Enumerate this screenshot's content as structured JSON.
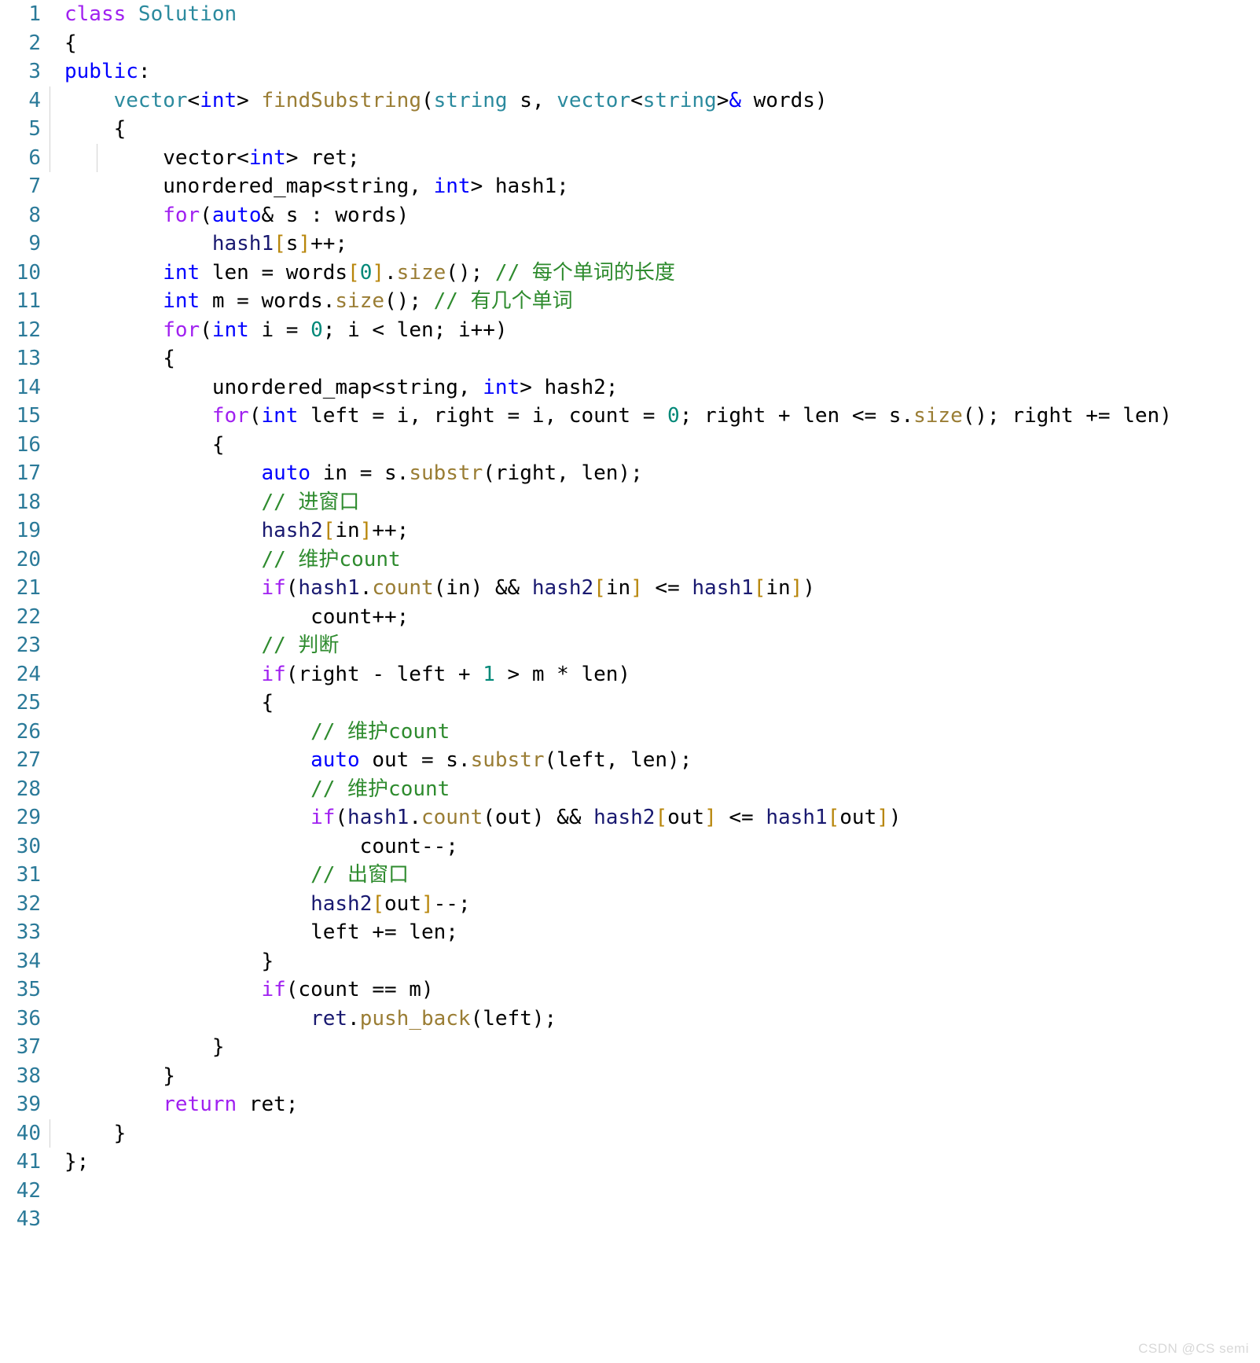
{
  "document": {
    "kind": "code-snippet",
    "language": "C++",
    "background_color": "#ffffff",
    "gutter_color": "#2b7a99",
    "watermark": "CSDN @CS semi"
  },
  "palette": {
    "keyword": "#a020f0",
    "type": "#0000ff",
    "return_type": "#2b8a9e",
    "function": "#9a7d34",
    "number": "#008878",
    "identifier": "#191970",
    "bracket": "#b8860b",
    "comment": "#2e8b2e",
    "plain": "#000000",
    "line_number": "#2b7a99"
  },
  "lines": [
    {
      "n": "1",
      "text": "class Solution"
    },
    {
      "n": "2",
      "text": "{"
    },
    {
      "n": "3",
      "text": "public:"
    },
    {
      "n": "4",
      "text": "    vector<int> findSubstring(string s, vector<string>& words)"
    },
    {
      "n": "5",
      "text": "    {"
    },
    {
      "n": "6",
      "text": "        vector<int> ret;"
    },
    {
      "n": "7",
      "text": "        unordered_map<string, int> hash1;"
    },
    {
      "n": "8",
      "text": "        for(auto& s : words)"
    },
    {
      "n": "9",
      "text": "            hash1[s]++;"
    },
    {
      "n": "10",
      "text": "        int len = words[0].size(); // 每个单词的长度"
    },
    {
      "n": "11",
      "text": "        int m = words.size(); // 有几个单词"
    },
    {
      "n": "12",
      "text": "        for(int i = 0; i < len; i++)"
    },
    {
      "n": "13",
      "text": "        {"
    },
    {
      "n": "14",
      "text": "            unordered_map<string, int> hash2;"
    },
    {
      "n": "15",
      "text": "            for(int left = i, right = i, count = 0; right + len <= s.size(); right += len)"
    },
    {
      "n": "16",
      "text": "            {"
    },
    {
      "n": "17",
      "text": "                auto in = s.substr(right, len);"
    },
    {
      "n": "18",
      "text": "                // 进窗口"
    },
    {
      "n": "19",
      "text": "                hash2[in]++;"
    },
    {
      "n": "20",
      "text": "                // 维护count"
    },
    {
      "n": "21",
      "text": "                if(hash1.count(in) && hash2[in] <= hash1[in])"
    },
    {
      "n": "22",
      "text": "                    count++;"
    },
    {
      "n": "23",
      "text": "                // 判断"
    },
    {
      "n": "24",
      "text": "                if(right - left + 1 > m * len)"
    },
    {
      "n": "25",
      "text": "                {"
    },
    {
      "n": "26",
      "text": "                    // 维护count"
    },
    {
      "n": "27",
      "text": "                    auto out = s.substr(left, len);"
    },
    {
      "n": "28",
      "text": "                    // 维护count"
    },
    {
      "n": "29",
      "text": "                    if(hash1.count(out) && hash2[out] <= hash1[out])"
    },
    {
      "n": "30",
      "text": "                        count--;"
    },
    {
      "n": "31",
      "text": "                    // 出窗口"
    },
    {
      "n": "32",
      "text": "                    hash2[out]--;"
    },
    {
      "n": "33",
      "text": "                    left += len;"
    },
    {
      "n": "34",
      "text": "                }"
    },
    {
      "n": "35",
      "text": "                if(count == m)"
    },
    {
      "n": "36",
      "text": "                    ret.push_back(left);"
    },
    {
      "n": "37",
      "text": "            }"
    },
    {
      "n": "38",
      "text": "        }"
    },
    {
      "n": "39",
      "text": "        return ret;"
    },
    {
      "n": "40",
      "text": "    }"
    },
    {
      "n": "41",
      "text": "};"
    },
    {
      "n": "42",
      "text": ""
    },
    {
      "n": "43",
      "text": ""
    }
  ],
  "highlighted_lines": [
    {
      "n": "1",
      "guides": [],
      "tokens": [
        {
          "t": "class ",
          "c": "kw"
        },
        {
          "t": "Solution",
          "c": "rettype"
        }
      ]
    },
    {
      "n": "2",
      "guides": [],
      "tokens": [
        {
          "t": "{",
          "c": "plain"
        }
      ]
    },
    {
      "n": "3",
      "guides": [],
      "tokens": [
        {
          "t": "public",
          "c": "type"
        },
        {
          "t": ":",
          "c": "plain"
        }
      ]
    },
    {
      "n": "4",
      "guides": [
        "g1"
      ],
      "tokens": [
        {
          "t": "    ",
          "c": "plain"
        },
        {
          "t": "vector",
          "c": "rettype"
        },
        {
          "t": "<",
          "c": "plain"
        },
        {
          "t": "int",
          "c": "type"
        },
        {
          "t": "> ",
          "c": "plain"
        },
        {
          "t": "findSubstring",
          "c": "fn"
        },
        {
          "t": "(",
          "c": "plain"
        },
        {
          "t": "string",
          "c": "rettype"
        },
        {
          "t": " s, ",
          "c": "plain"
        },
        {
          "t": "vector",
          "c": "rettype"
        },
        {
          "t": "<",
          "c": "plain"
        },
        {
          "t": "string",
          "c": "rettype"
        },
        {
          "t": ">",
          "c": "plain"
        },
        {
          "t": "&",
          "c": "amp"
        },
        {
          "t": " words)",
          "c": "plain"
        }
      ]
    },
    {
      "n": "5",
      "guides": [
        "g1"
      ],
      "tokens": [
        {
          "t": "    {",
          "c": "plain"
        }
      ]
    },
    {
      "n": "6",
      "guides": [
        "g1",
        "g2"
      ],
      "tokens": [
        {
          "t": "        vector",
          "c": "plain"
        },
        {
          "t": "<",
          "c": "plain"
        },
        {
          "t": "int",
          "c": "type"
        },
        {
          "t": "> ret;",
          "c": "plain"
        }
      ]
    },
    {
      "n": "7",
      "guides": [],
      "tokens": [
        {
          "t": "        unordered_map<string, ",
          "c": "plain"
        },
        {
          "t": "int",
          "c": "type"
        },
        {
          "t": "> hash1;",
          "c": "plain"
        }
      ]
    },
    {
      "n": "8",
      "guides": [],
      "tokens": [
        {
          "t": "        ",
          "c": "plain"
        },
        {
          "t": "for",
          "c": "kw"
        },
        {
          "t": "(",
          "c": "plain"
        },
        {
          "t": "auto",
          "c": "type"
        },
        {
          "t": "& s : words)",
          "c": "plain"
        }
      ]
    },
    {
      "n": "9",
      "guides": [],
      "tokens": [
        {
          "t": "            ",
          "c": "plain"
        },
        {
          "t": "hash1",
          "c": "ident"
        },
        {
          "t": "[",
          "c": "brk"
        },
        {
          "t": "s",
          "c": "plain"
        },
        {
          "t": "]",
          "c": "brk"
        },
        {
          "t": "++;",
          "c": "plain"
        }
      ]
    },
    {
      "n": "10",
      "guides": [],
      "tokens": [
        {
          "t": "        ",
          "c": "plain"
        },
        {
          "t": "int",
          "c": "type"
        },
        {
          "t": " len = words",
          "c": "plain"
        },
        {
          "t": "[",
          "c": "brk"
        },
        {
          "t": "0",
          "c": "num"
        },
        {
          "t": "]",
          "c": "brk"
        },
        {
          "t": ".",
          "c": "plain"
        },
        {
          "t": "size",
          "c": "fn"
        },
        {
          "t": "(); ",
          "c": "plain"
        },
        {
          "t": "// 每个单词的长度",
          "c": "cmt"
        }
      ]
    },
    {
      "n": "11",
      "guides": [],
      "tokens": [
        {
          "t": "        ",
          "c": "plain"
        },
        {
          "t": "int",
          "c": "type"
        },
        {
          "t": " m = words.",
          "c": "plain"
        },
        {
          "t": "size",
          "c": "fn"
        },
        {
          "t": "(); ",
          "c": "plain"
        },
        {
          "t": "// 有几个单词",
          "c": "cmt"
        }
      ]
    },
    {
      "n": "12",
      "guides": [],
      "tokens": [
        {
          "t": "        ",
          "c": "plain"
        },
        {
          "t": "for",
          "c": "kw"
        },
        {
          "t": "(",
          "c": "plain"
        },
        {
          "t": "int",
          "c": "type"
        },
        {
          "t": " i = ",
          "c": "plain"
        },
        {
          "t": "0",
          "c": "num"
        },
        {
          "t": "; i < len; i++)",
          "c": "plain"
        }
      ]
    },
    {
      "n": "13",
      "guides": [],
      "tokens": [
        {
          "t": "        {",
          "c": "plain"
        }
      ]
    },
    {
      "n": "14",
      "guides": [],
      "tokens": [
        {
          "t": "            unordered_map<string, ",
          "c": "plain"
        },
        {
          "t": "int",
          "c": "type"
        },
        {
          "t": "> hash2;",
          "c": "plain"
        }
      ]
    },
    {
      "n": "15",
      "guides": [],
      "tokens": [
        {
          "t": "            ",
          "c": "plain"
        },
        {
          "t": "for",
          "c": "kw"
        },
        {
          "t": "(",
          "c": "plain"
        },
        {
          "t": "int",
          "c": "type"
        },
        {
          "t": " left = i, right = i, count = ",
          "c": "plain"
        },
        {
          "t": "0",
          "c": "num"
        },
        {
          "t": "; right + len <= s.",
          "c": "plain"
        },
        {
          "t": "size",
          "c": "fn"
        },
        {
          "t": "(); right += len)",
          "c": "plain"
        }
      ]
    },
    {
      "n": "16",
      "guides": [],
      "tokens": [
        {
          "t": "            {",
          "c": "plain"
        }
      ]
    },
    {
      "n": "17",
      "guides": [],
      "tokens": [
        {
          "t": "                ",
          "c": "plain"
        },
        {
          "t": "auto",
          "c": "type"
        },
        {
          "t": " in = s.",
          "c": "plain"
        },
        {
          "t": "substr",
          "c": "fn"
        },
        {
          "t": "(right, len);",
          "c": "plain"
        }
      ]
    },
    {
      "n": "18",
      "guides": [],
      "tokens": [
        {
          "t": "                ",
          "c": "plain"
        },
        {
          "t": "// 进窗口",
          "c": "cmt"
        }
      ]
    },
    {
      "n": "19",
      "guides": [],
      "tokens": [
        {
          "t": "                ",
          "c": "plain"
        },
        {
          "t": "hash2",
          "c": "ident"
        },
        {
          "t": "[",
          "c": "brk"
        },
        {
          "t": "in",
          "c": "plain"
        },
        {
          "t": "]",
          "c": "brk"
        },
        {
          "t": "++;",
          "c": "plain"
        }
      ]
    },
    {
      "n": "20",
      "guides": [],
      "tokens": [
        {
          "t": "                ",
          "c": "plain"
        },
        {
          "t": "// 维护count",
          "c": "cmt"
        }
      ]
    },
    {
      "n": "21",
      "guides": [],
      "tokens": [
        {
          "t": "                ",
          "c": "plain"
        },
        {
          "t": "if",
          "c": "kw"
        },
        {
          "t": "(",
          "c": "plain"
        },
        {
          "t": "hash1",
          "c": "ident"
        },
        {
          "t": ".",
          "c": "plain"
        },
        {
          "t": "count",
          "c": "fn"
        },
        {
          "t": "(in) && ",
          "c": "plain"
        },
        {
          "t": "hash2",
          "c": "ident"
        },
        {
          "t": "[",
          "c": "brk"
        },
        {
          "t": "in",
          "c": "plain"
        },
        {
          "t": "]",
          "c": "brk"
        },
        {
          "t": " <= ",
          "c": "plain"
        },
        {
          "t": "hash1",
          "c": "ident"
        },
        {
          "t": "[",
          "c": "brk"
        },
        {
          "t": "in",
          "c": "plain"
        },
        {
          "t": "]",
          "c": "brk"
        },
        {
          "t": ")",
          "c": "plain"
        }
      ]
    },
    {
      "n": "22",
      "guides": [],
      "tokens": [
        {
          "t": "                    count++;",
          "c": "plain"
        }
      ]
    },
    {
      "n": "23",
      "guides": [],
      "tokens": [
        {
          "t": "                ",
          "c": "plain"
        },
        {
          "t": "// 判断",
          "c": "cmt"
        }
      ]
    },
    {
      "n": "24",
      "guides": [],
      "tokens": [
        {
          "t": "                ",
          "c": "plain"
        },
        {
          "t": "if",
          "c": "kw"
        },
        {
          "t": "(right - left + ",
          "c": "plain"
        },
        {
          "t": "1",
          "c": "num"
        },
        {
          "t": " > m * len)",
          "c": "plain"
        }
      ]
    },
    {
      "n": "25",
      "guides": [],
      "tokens": [
        {
          "t": "                {",
          "c": "plain"
        }
      ]
    },
    {
      "n": "26",
      "guides": [],
      "tokens": [
        {
          "t": "                    ",
          "c": "plain"
        },
        {
          "t": "// 维护count",
          "c": "cmt"
        }
      ]
    },
    {
      "n": "27",
      "guides": [],
      "tokens": [
        {
          "t": "                    ",
          "c": "plain"
        },
        {
          "t": "auto",
          "c": "type"
        },
        {
          "t": " out = s.",
          "c": "plain"
        },
        {
          "t": "substr",
          "c": "fn"
        },
        {
          "t": "(left, len);",
          "c": "plain"
        }
      ]
    },
    {
      "n": "28",
      "guides": [],
      "tokens": [
        {
          "t": "                    ",
          "c": "plain"
        },
        {
          "t": "// 维护count",
          "c": "cmt"
        }
      ]
    },
    {
      "n": "29",
      "guides": [],
      "tokens": [
        {
          "t": "                    ",
          "c": "plain"
        },
        {
          "t": "if",
          "c": "kw"
        },
        {
          "t": "(",
          "c": "plain"
        },
        {
          "t": "hash1",
          "c": "ident"
        },
        {
          "t": ".",
          "c": "plain"
        },
        {
          "t": "count",
          "c": "fn"
        },
        {
          "t": "(out) && ",
          "c": "plain"
        },
        {
          "t": "hash2",
          "c": "ident"
        },
        {
          "t": "[",
          "c": "brk"
        },
        {
          "t": "out",
          "c": "plain"
        },
        {
          "t": "]",
          "c": "brk"
        },
        {
          "t": " <= ",
          "c": "plain"
        },
        {
          "t": "hash1",
          "c": "ident"
        },
        {
          "t": "[",
          "c": "brk"
        },
        {
          "t": "out",
          "c": "plain"
        },
        {
          "t": "]",
          "c": "brk"
        },
        {
          "t": ")",
          "c": "plain"
        }
      ]
    },
    {
      "n": "30",
      "guides": [],
      "tokens": [
        {
          "t": "                        count--;",
          "c": "plain"
        }
      ]
    },
    {
      "n": "31",
      "guides": [],
      "tokens": [
        {
          "t": "                    ",
          "c": "plain"
        },
        {
          "t": "// 出窗口",
          "c": "cmt"
        }
      ]
    },
    {
      "n": "32",
      "guides": [],
      "tokens": [
        {
          "t": "                    ",
          "c": "plain"
        },
        {
          "t": "hash2",
          "c": "ident"
        },
        {
          "t": "[",
          "c": "brk"
        },
        {
          "t": "out",
          "c": "plain"
        },
        {
          "t": "]",
          "c": "brk"
        },
        {
          "t": "--;",
          "c": "plain"
        }
      ]
    },
    {
      "n": "33",
      "guides": [],
      "tokens": [
        {
          "t": "                    left += len;",
          "c": "plain"
        }
      ]
    },
    {
      "n": "34",
      "guides": [],
      "tokens": [
        {
          "t": "                }",
          "c": "plain"
        }
      ]
    },
    {
      "n": "35",
      "guides": [],
      "tokens": [
        {
          "t": "                ",
          "c": "plain"
        },
        {
          "t": "if",
          "c": "kw"
        },
        {
          "t": "(count == m)",
          "c": "plain"
        }
      ]
    },
    {
      "n": "36",
      "guides": [],
      "tokens": [
        {
          "t": "                    ",
          "c": "plain"
        },
        {
          "t": "ret",
          "c": "ident"
        },
        {
          "t": ".",
          "c": "plain"
        },
        {
          "t": "push_back",
          "c": "fn"
        },
        {
          "t": "(left);",
          "c": "plain"
        }
      ]
    },
    {
      "n": "37",
      "guides": [],
      "tokens": [
        {
          "t": "            }",
          "c": "plain"
        }
      ]
    },
    {
      "n": "38",
      "guides": [],
      "tokens": [
        {
          "t": "        }",
          "c": "plain"
        }
      ]
    },
    {
      "n": "39",
      "guides": [],
      "tokens": [
        {
          "t": "        ",
          "c": "plain"
        },
        {
          "t": "return",
          "c": "kw"
        },
        {
          "t": " ret;",
          "c": "plain"
        }
      ]
    },
    {
      "n": "40",
      "guides": [
        "g1"
      ],
      "tokens": [
        {
          "t": "    }",
          "c": "plain"
        }
      ]
    },
    {
      "n": "41",
      "guides": [],
      "tokens": [
        {
          "t": "};",
          "c": "plain"
        }
      ]
    },
    {
      "n": "42",
      "guides": [],
      "tokens": []
    },
    {
      "n": "43",
      "guides": [],
      "tokens": []
    }
  ]
}
